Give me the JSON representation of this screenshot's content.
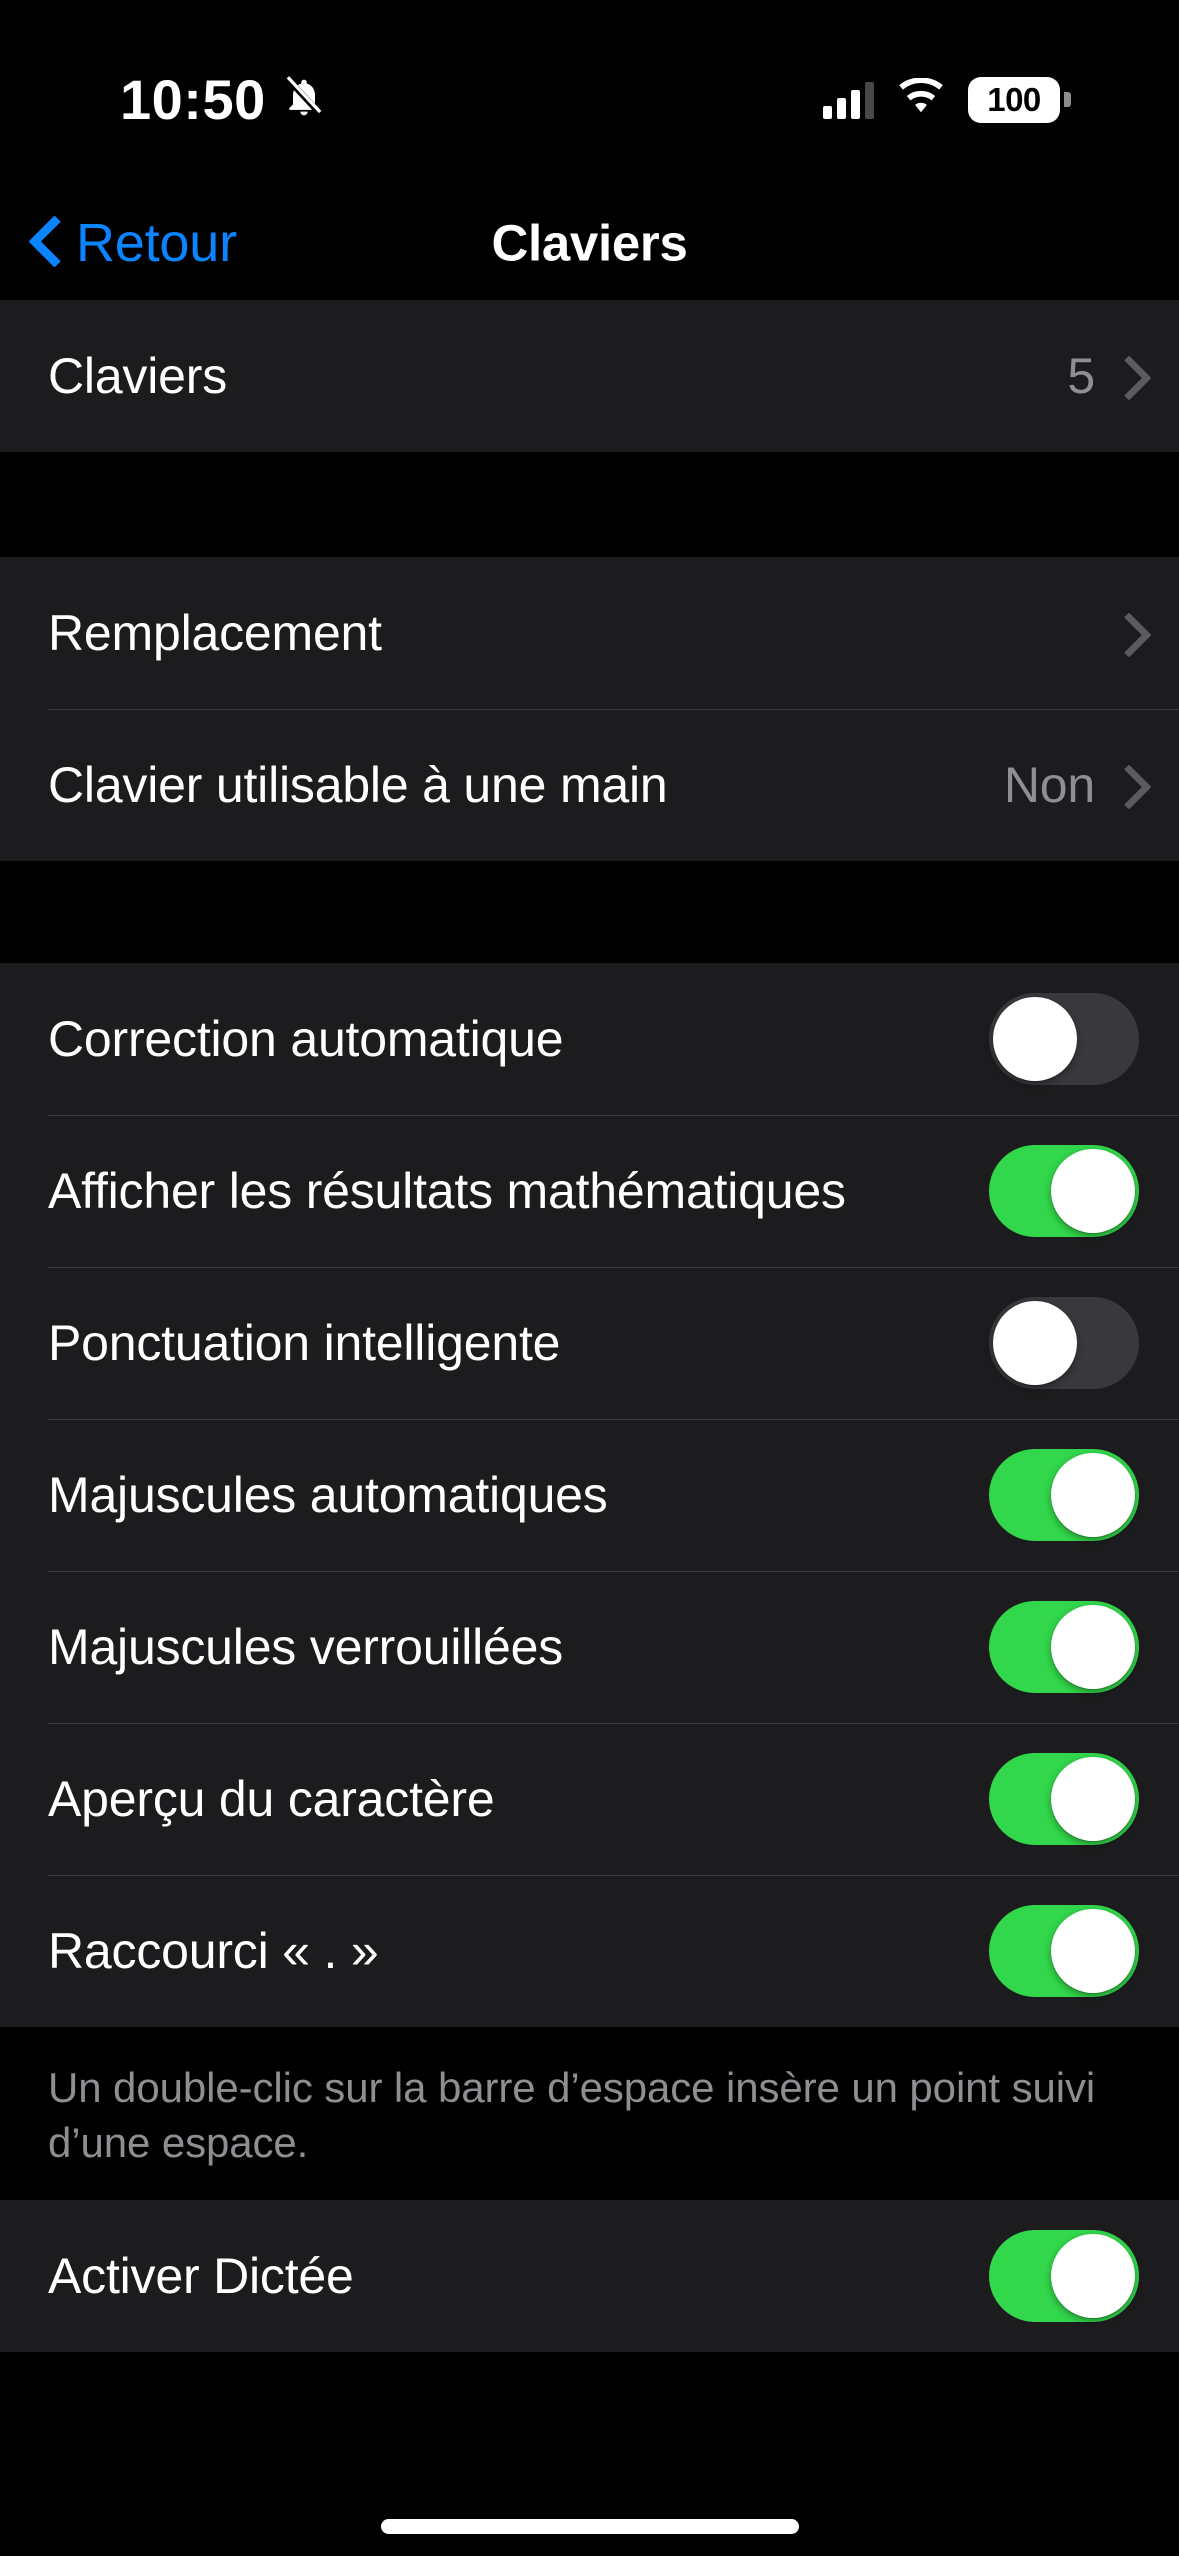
{
  "status_bar": {
    "time": "10:50",
    "silent_icon": "bell-slash-icon",
    "cellular_icon": "cellular-bars-icon",
    "wifi_icon": "wifi-icon",
    "battery_level": "100",
    "battery_icon": "battery-full-icon"
  },
  "nav": {
    "back_label": "Retour",
    "back_icon": "chevron-left-icon",
    "title": "Claviers"
  },
  "groups": [
    {
      "rows": [
        {
          "label": "Claviers",
          "value": "5",
          "type": "disclosure"
        }
      ]
    },
    {
      "rows": [
        {
          "label": "Remplacement",
          "value": "",
          "type": "disclosure"
        },
        {
          "label": "Clavier utilisable à une main",
          "value": "Non",
          "type": "disclosure"
        }
      ]
    },
    {
      "rows": [
        {
          "label": "Correction automatique",
          "type": "switch",
          "on": false
        },
        {
          "label": "Afficher les résultats mathématiques",
          "type": "switch",
          "on": true
        },
        {
          "label": "Ponctuation intelligente",
          "type": "switch",
          "on": false
        },
        {
          "label": "Majuscules automatiques",
          "type": "switch",
          "on": true
        },
        {
          "label": "Majuscules verrouillées",
          "type": "switch",
          "on": true
        },
        {
          "label": "Aperçu du caractère",
          "type": "switch",
          "on": true
        },
        {
          "label": "Raccourci « . »",
          "type": "switch",
          "on": true
        }
      ],
      "footer": "Un double-clic sur la barre d’espace insère un point suivi d’une espace."
    },
    {
      "rows": [
        {
          "label": "Activer Dictée",
          "type": "switch",
          "on": true
        }
      ]
    }
  ],
  "colors": {
    "accent_blue": "#0a84ff",
    "switch_on_green": "#32d74b",
    "switch_off_gray": "#39393d",
    "row_background": "#1c1c1e",
    "page_background": "#000000",
    "secondary_text": "#8e8e93"
  }
}
